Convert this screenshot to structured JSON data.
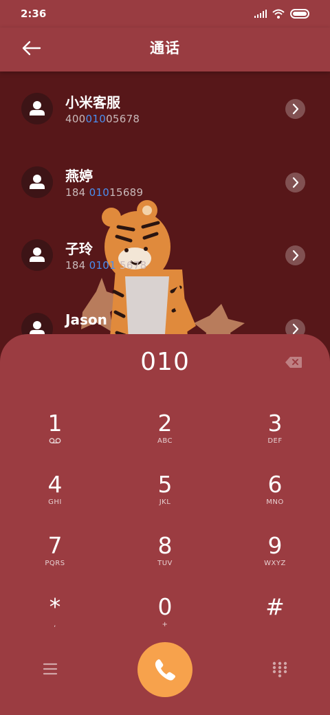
{
  "status_bar": {
    "time": "2:36"
  },
  "header": {
    "title": "通话"
  },
  "contacts": [
    {
      "name": "小米客服",
      "number_pre": "400",
      "number_match": "010",
      "number_post": "05678"
    },
    {
      "name": "燕婷",
      "number_pre": "184 ",
      "number_match": "010",
      "number_post": "15689"
    },
    {
      "name": "子玲",
      "number_pre": "184 ",
      "number_match": "0101",
      "number_post": " 5678"
    },
    {
      "name": "Jason",
      "number_pre": "",
      "number_match": "",
      "number_post": ""
    }
  ],
  "dialer": {
    "entered_digits": "010",
    "keys": [
      {
        "digit": "1",
        "sub": ""
      },
      {
        "digit": "2",
        "sub": "ABC"
      },
      {
        "digit": "3",
        "sub": "DEF"
      },
      {
        "digit": "4",
        "sub": "GHI"
      },
      {
        "digit": "5",
        "sub": "JKL"
      },
      {
        "digit": "6",
        "sub": "MNO"
      },
      {
        "digit": "7",
        "sub": "PQRS"
      },
      {
        "digit": "8",
        "sub": "TUV"
      },
      {
        "digit": "9",
        "sub": "WXYZ"
      },
      {
        "digit": "*",
        "sub": ","
      },
      {
        "digit": "0",
        "sub": "+"
      },
      {
        "digit": "#",
        "sub": ""
      }
    ]
  },
  "colors": {
    "header_bg": "#993c41",
    "list_bg": "#571719",
    "pad_bg": "#9b3c41",
    "call_button": "#f7a24c",
    "match_highlight": "#4a8ff0"
  },
  "icons": {
    "back": "arrow-left-icon",
    "chevron": "chevron-right-icon",
    "backspace": "backspace-icon",
    "voicemail": "voicemail-icon",
    "menu": "menu-icon",
    "call": "phone-icon",
    "dialpad": "dialpad-icon"
  }
}
